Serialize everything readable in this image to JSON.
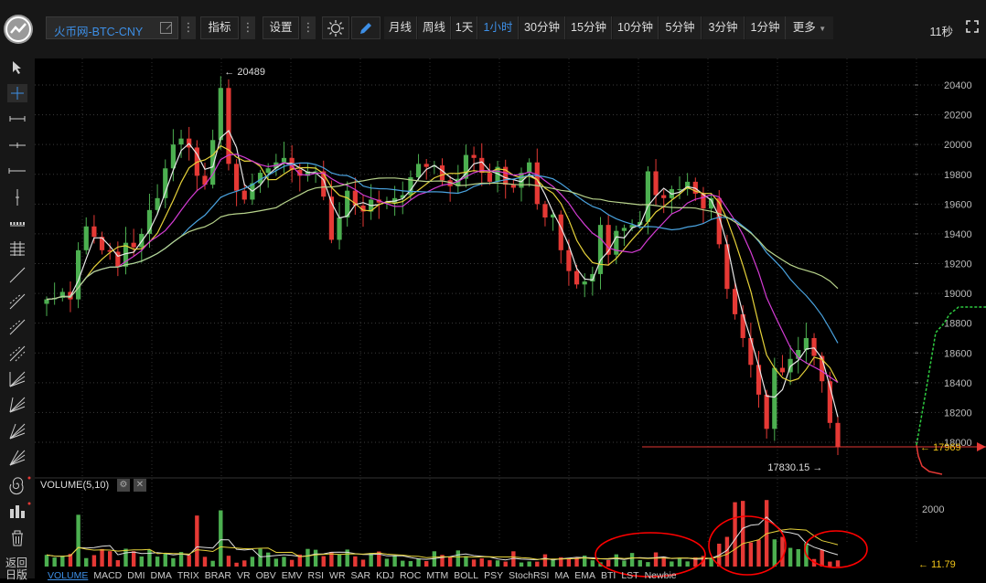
{
  "toolbar": {
    "symbol": "火币网-BTC-CNY",
    "indicators_label": "指标",
    "settings_label": "设置",
    "timeframes": [
      "月线",
      "周线",
      "1天",
      "1小时",
      "30分钟",
      "15分钟",
      "10分钟",
      "5分钟",
      "3分钟",
      "1分钟"
    ],
    "active_timeframe": "1小时",
    "more_label": "更多",
    "timer": "11秒"
  },
  "sidebar": {
    "tools": [
      "cursor-icon",
      "crosshair-icon",
      "segment-icon",
      "horizontal-ray-icon",
      "horizontal-line-icon",
      "vertical-line-icon",
      "price-range-icon",
      "parallel-channel-icon",
      "trend-line-icon",
      "ray-icon",
      "extended-line-icon",
      "arrow-icon",
      "fib-fan-icon",
      "fib-fan-2-icon",
      "fib-fan-3-icon",
      "pitchfork-icon",
      "spiral-icon",
      "pattern-icon",
      "trash-icon"
    ],
    "return_label": "返回\n日版"
  },
  "price_axis": {
    "ticks": [
      "20400",
      "20200",
      "20000",
      "19800",
      "19600",
      "19400",
      "19200",
      "19000",
      "18800",
      "18600",
      "18400",
      "18200",
      "18000"
    ],
    "current_price": "17969",
    "high_label": "20489",
    "low_label": "17830.15"
  },
  "volume_panel": {
    "label": "VOLUME(5,10)",
    "axis_tick": "2000",
    "current_value": "11.79"
  },
  "indicator_tabs": [
    "VOLUME",
    "MACD",
    "DMI",
    "DMA",
    "TRIX",
    "BRAR",
    "VR",
    "OBV",
    "EMV",
    "RSI",
    "WR",
    "SAR",
    "KDJ",
    "ROC",
    "MTM",
    "BOLL",
    "PSY",
    "StochRSI",
    "MA",
    "EMA",
    "BTI",
    "LST",
    "Newbie"
  ],
  "colors": {
    "up": "#4caf50",
    "down": "#e53935",
    "accent": "#3d8fe6",
    "annotation": "#ff0000"
  },
  "chart_data": {
    "type": "candlestick",
    "ylim": [
      17800,
      20500
    ],
    "close": [
      18960,
      18970,
      19010,
      18960,
      19290,
      19450,
      19380,
      19290,
      19280,
      19180,
      19340,
      19310,
      19400,
      19560,
      19640,
      19840,
      20000,
      20040,
      19980,
      19790,
      19730,
      20030,
      20380,
      19870,
      19690,
      19630,
      19740,
      19810,
      19840,
      19880,
      19910,
      19830,
      19790,
      19820,
      19820,
      19650,
      19360,
      19510,
      19690,
      19590,
      19550,
      19630,
      19610,
      19610,
      19640,
      19660,
      19780,
      19870,
      19850,
      19860,
      19760,
      19720,
      19770,
      19930,
      19910,
      19810,
      19750,
      19850,
      19730,
      19710,
      19810,
      19880,
      19600,
      19510,
      19530,
      19290,
      19150,
      19060,
      19080,
      19130,
      19460,
      19260,
      19420,
      19440,
      19460,
      19480,
      19820,
      19660,
      19640,
      19700,
      19700,
      19750,
      19670,
      19570,
      19640,
      19330,
      19030,
      18860,
      18700,
      18520,
      18320,
      18090,
      18500,
      18470,
      18560,
      18620,
      18700,
      18580,
      18410,
      18130,
      17969
    ]
  }
}
